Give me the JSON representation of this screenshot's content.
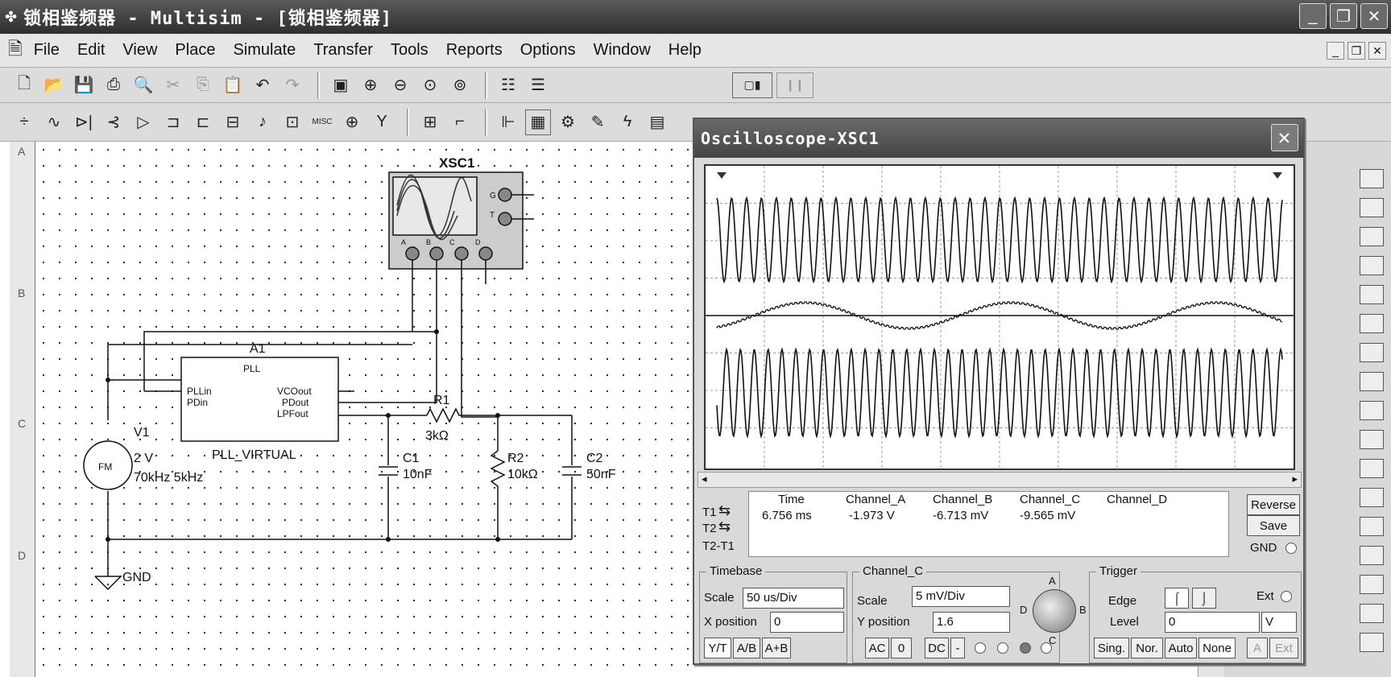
{
  "window": {
    "title": "锁相鉴频器 - Multisim - [锁相鉴频器]"
  },
  "menu": [
    "File",
    "Edit",
    "View",
    "Place",
    "Simulate",
    "Transfer",
    "Tools",
    "Reports",
    "Options",
    "Window",
    "Help"
  ],
  "rows": [
    "A",
    "B",
    "C",
    "D"
  ],
  "schematic": {
    "instrument": "XSC1",
    "inst_port_labels": [
      "A",
      "B",
      "C",
      "D"
    ],
    "inst_gt": [
      "G",
      "T"
    ],
    "pll_ref": "A1",
    "pll_type": "PLL",
    "pll_in": "PLLin",
    "pll_pd_in": "PDin",
    "pll_vco_out": "VCOout",
    "pll_pd_out": "PDout",
    "pll_lpf_out": "LPFout",
    "pll_name": "PLL_VIRTUAL",
    "source_ref": "V1",
    "source_type": "FM",
    "source_amp": "2 V",
    "source_freq": "70kHz 5kHz",
    "r1": "R1",
    "r1_val": "3kΩ",
    "r2": "R2",
    "r2_val": "10kΩ",
    "c1": "C1",
    "c1_val": "10nF",
    "c2": "C2",
    "c2_val": "50nF",
    "gnd": "GND"
  },
  "oscilloscope": {
    "title": "Oscilloscope-XSC1",
    "readout_headers": [
      "Time",
      "Channel_A",
      "Channel_B",
      "Channel_C",
      "Channel_D"
    ],
    "t1_values": [
      "6.756 ms",
      "-1.973 V",
      "-6.713 mV",
      "-9.565 mV",
      ""
    ],
    "t1_label": "T1",
    "t2_label": "T2",
    "t21_label": "T2-T1",
    "reverse": "Reverse",
    "save": "Save",
    "gnd": "GND",
    "timebase": {
      "title": "Timebase",
      "scale_label": "Scale",
      "scale": "50 us/Div",
      "xpos_label": "X position",
      "xpos": "0",
      "modes": [
        "Y/T",
        "A/B",
        "A+B"
      ]
    },
    "channel": {
      "title": "Channel_C",
      "scale_label": "Scale",
      "scale": "5 mV/Div",
      "ypos_label": "Y position",
      "ypos": "1.6",
      "coupling": [
        "AC",
        "0",
        "DC",
        "-"
      ],
      "knob_labels": [
        "A",
        "B",
        "C",
        "D"
      ]
    },
    "trigger": {
      "title": "Trigger",
      "edge_label": "Edge",
      "ext_label": "Ext",
      "level_label": "Level",
      "level": "0",
      "level_unit": "V",
      "modes": [
        "Sing.",
        "Nor.",
        "Auto",
        "None"
      ],
      "sources": [
        "A",
        "Ext"
      ]
    }
  }
}
